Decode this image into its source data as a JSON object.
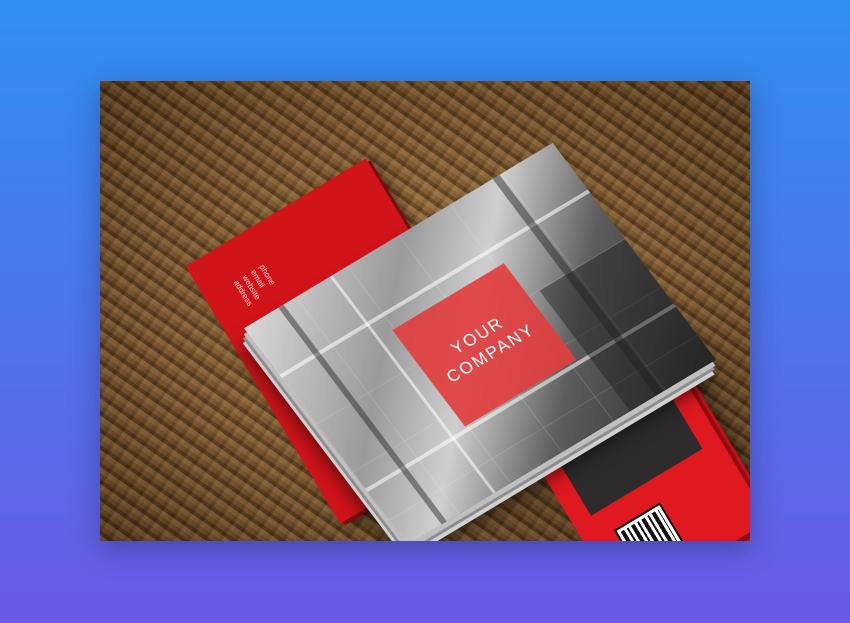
{
  "image": {
    "subject": "business card mockup",
    "surface": "burlap-texture",
    "colors": {
      "background_top": "#2f8ff0",
      "background_bottom": "#6a5ae6",
      "card_red": "#e0181f",
      "logo_red": "#e23e3e",
      "panel_dark": "#2d2b2c"
    }
  },
  "front_card": {
    "logo_line1": "YOUR",
    "logo_line2": "COMPANY"
  },
  "back_card": {
    "contact": [
      "phone",
      "email",
      "website",
      "address"
    ]
  },
  "icons": [
    "qr-code-icon"
  ]
}
